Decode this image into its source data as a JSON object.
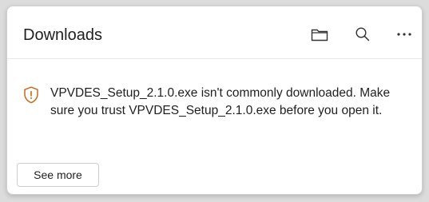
{
  "downloads_panel": {
    "title": "Downloads",
    "toolbar": {
      "folder_icon": "folder-icon",
      "search_icon": "search-icon",
      "more_icon": "more-options-icon"
    },
    "warning": {
      "icon": "shield-warning-icon",
      "accent_color": "#c56a1d",
      "message": "VPVDES_Setup_2.1.0.exe isn't commonly downloaded. Make sure you trust VPVDES_Setup_2.1.0.exe before you open it."
    },
    "see_more_label": "See more"
  }
}
